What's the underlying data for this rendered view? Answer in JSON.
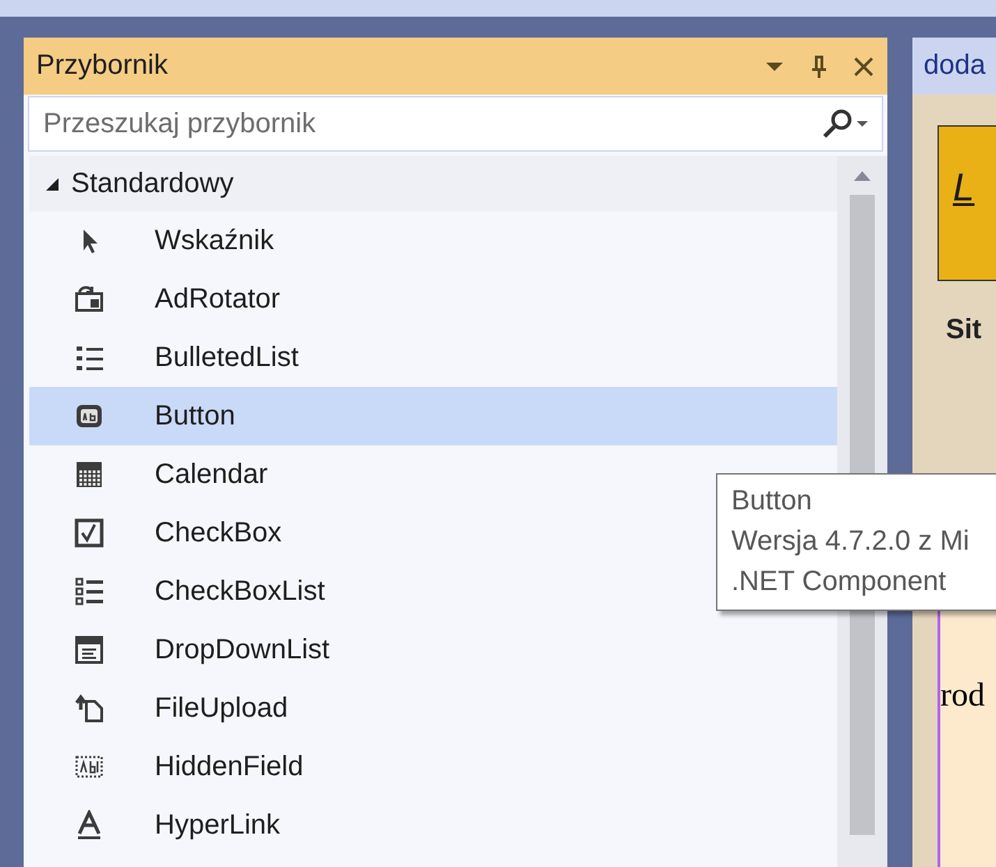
{
  "toolbox": {
    "title": "Przybornik",
    "search": {
      "placeholder": "Przeszukaj przybornik"
    },
    "group": {
      "label": "Standardowy",
      "expanded": true,
      "items": [
        {
          "label": "Wskaźnik",
          "kind": "pointer",
          "selected": false
        },
        {
          "label": "AdRotator",
          "kind": "adrotator",
          "selected": false
        },
        {
          "label": "BulletedList",
          "kind": "bulletedlist",
          "selected": false
        },
        {
          "label": "Button",
          "kind": "button",
          "selected": true
        },
        {
          "label": "Calendar",
          "kind": "calendar",
          "selected": false
        },
        {
          "label": "CheckBox",
          "kind": "checkbox",
          "selected": false
        },
        {
          "label": "CheckBoxList",
          "kind": "checkboxlist",
          "selected": false
        },
        {
          "label": "DropDownList",
          "kind": "dropdownlist",
          "selected": false
        },
        {
          "label": "FileUpload",
          "kind": "fileupload",
          "selected": false
        },
        {
          "label": "HiddenField",
          "kind": "hiddenfield",
          "selected": false
        },
        {
          "label": "HyperLink",
          "kind": "hyperlink",
          "selected": false
        }
      ]
    }
  },
  "tooltip": {
    "lines": [
      "Button",
      "Wersja 4.7.2.0 z Mi",
      ".NET Component"
    ]
  },
  "document": {
    "tab": "doda",
    "heading": "L",
    "label": "Sit",
    "text": "rod"
  }
}
